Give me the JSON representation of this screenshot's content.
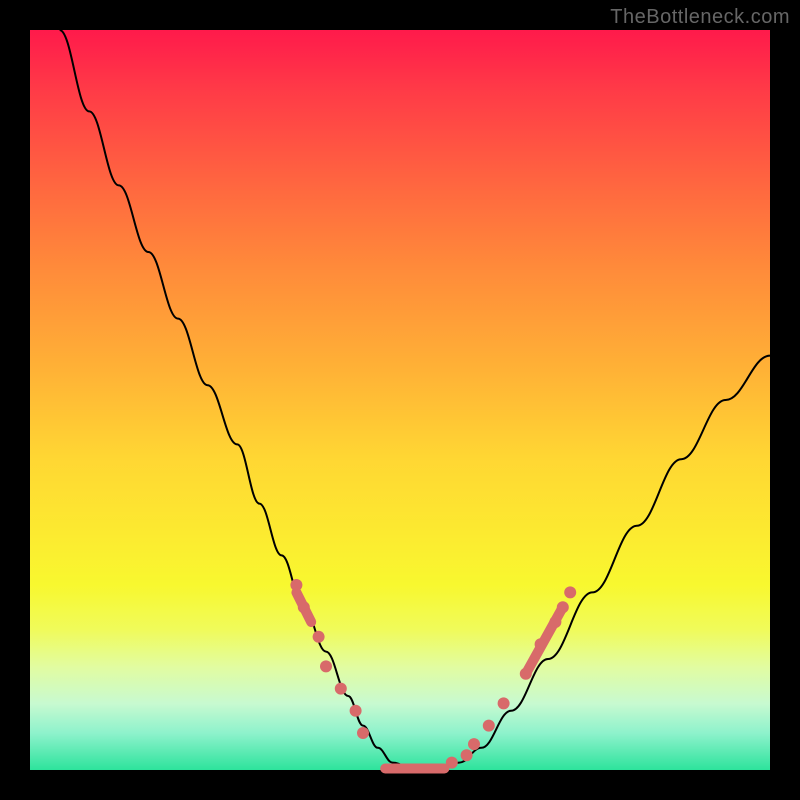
{
  "watermark": "TheBottleneck.com",
  "chart_data": {
    "type": "line",
    "title": "",
    "xlabel": "",
    "ylabel": "",
    "xlim": [
      0,
      100
    ],
    "ylim": [
      0,
      100
    ],
    "grid": false,
    "series": [
      {
        "name": "curve",
        "x": [
          4,
          8,
          12,
          16,
          20,
          24,
          28,
          31,
          34,
          37,
          40,
          43,
          45,
          47,
          49,
          52,
          55,
          58,
          61,
          65,
          70,
          76,
          82,
          88,
          94,
          100
        ],
        "y": [
          100,
          89,
          79,
          70,
          61,
          52,
          44,
          36,
          29,
          22,
          16,
          10,
          6,
          3,
          1,
          0,
          0,
          1,
          3,
          8,
          15,
          24,
          33,
          42,
          50,
          56
        ]
      }
    ],
    "markers": {
      "left_arm": [
        {
          "x": 36,
          "y": 25
        },
        {
          "x": 37,
          "y": 22
        },
        {
          "x": 39,
          "y": 18
        },
        {
          "x": 40,
          "y": 14
        },
        {
          "x": 42,
          "y": 11
        },
        {
          "x": 44,
          "y": 8
        },
        {
          "x": 45,
          "y": 5
        }
      ],
      "bottom_band": {
        "x_start": 48,
        "x_end": 56,
        "y": 0.2
      },
      "right_arm": [
        {
          "x": 57,
          "y": 1
        },
        {
          "x": 59,
          "y": 2
        },
        {
          "x": 60,
          "y": 3.5
        },
        {
          "x": 62,
          "y": 6
        },
        {
          "x": 64,
          "y": 9
        },
        {
          "x": 67,
          "y": 13
        },
        {
          "x": 69,
          "y": 17
        },
        {
          "x": 71,
          "y": 20
        },
        {
          "x": 72,
          "y": 22
        },
        {
          "x": 73,
          "y": 24
        }
      ]
    }
  }
}
